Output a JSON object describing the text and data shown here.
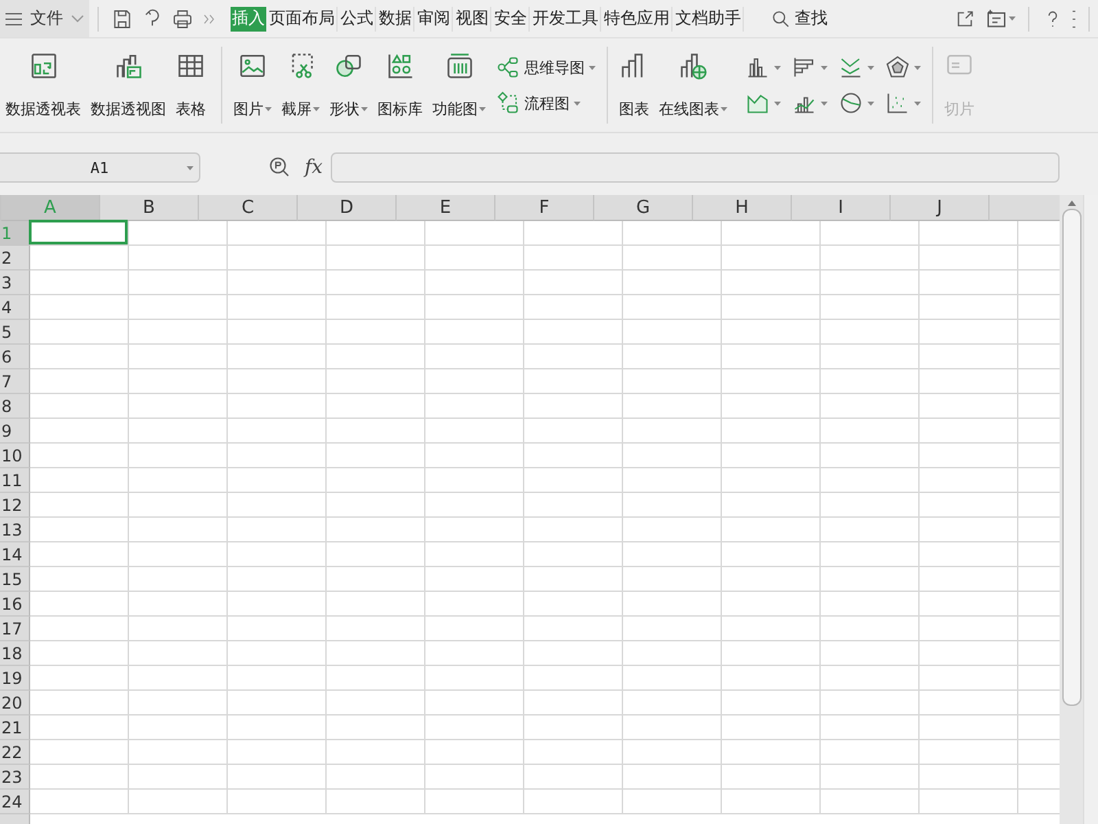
{
  "menu": {
    "label": "文件"
  },
  "tabs": [
    {
      "label": "插入",
      "selected": true
    },
    {
      "label": "页面布局",
      "selected": false
    },
    {
      "label": "公式",
      "selected": false
    },
    {
      "label": "数据",
      "selected": false
    },
    {
      "label": "审阅",
      "selected": false
    },
    {
      "label": "视图",
      "selected": false
    },
    {
      "label": "安全",
      "selected": false
    },
    {
      "label": "开发工具",
      "selected": false
    },
    {
      "label": "特色应用",
      "selected": false
    },
    {
      "label": "文档助手",
      "selected": false
    }
  ],
  "search": {
    "label": "查找"
  },
  "ribbon": [
    {
      "kind": "large",
      "label": "数据透视表",
      "dropdown": false,
      "disabled": false
    },
    {
      "kind": "large",
      "label": "数据透视图",
      "dropdown": false,
      "disabled": false
    },
    {
      "kind": "large",
      "label": "表格",
      "dropdown": false,
      "disabled": false
    },
    {
      "kind": "separator"
    },
    {
      "kind": "large",
      "label": "图片",
      "dropdown": true,
      "disabled": false
    },
    {
      "kind": "large",
      "label": "截屏",
      "dropdown": true,
      "disabled": false
    },
    {
      "kind": "large",
      "label": "形状",
      "dropdown": true,
      "disabled": false
    },
    {
      "kind": "large",
      "label": "图标库",
      "dropdown": false,
      "disabled": false
    },
    {
      "kind": "large",
      "label": "功能图",
      "dropdown": true,
      "disabled": false
    },
    {
      "kind": "stack",
      "items": [
        {
          "label": "思维导图",
          "dropdown": true
        },
        {
          "label": "流程图",
          "dropdown": true
        }
      ]
    },
    {
      "kind": "separator"
    },
    {
      "kind": "large",
      "label": "图表",
      "dropdown": false,
      "disabled": false
    },
    {
      "kind": "large",
      "label": "在线图表",
      "dropdown": true,
      "disabled": false
    },
    {
      "kind": "charts",
      "items": [
        {
          "kind": "column"
        },
        {
          "kind": "bar"
        },
        {
          "kind": "line"
        },
        {
          "kind": "radar"
        },
        {
          "kind": "area"
        },
        {
          "kind": "combo"
        },
        {
          "kind": "pie"
        },
        {
          "kind": "scatter"
        }
      ]
    },
    {
      "kind": "separator"
    },
    {
      "kind": "large",
      "label": "切片",
      "dropdown": false,
      "disabled": true
    }
  ],
  "name_box": {
    "value": "A1"
  },
  "formula_label": "fx",
  "columns": [
    {
      "label": "A",
      "selected": true
    },
    {
      "label": "B",
      "selected": false
    },
    {
      "label": "C",
      "selected": false
    },
    {
      "label": "D",
      "selected": false
    },
    {
      "label": "E",
      "selected": false
    },
    {
      "label": "F",
      "selected": false
    },
    {
      "label": "G",
      "selected": false
    },
    {
      "label": "H",
      "selected": false
    },
    {
      "label": "I",
      "selected": false
    },
    {
      "label": "J",
      "selected": false
    }
  ],
  "rows": [
    {
      "label": "1",
      "selected": true
    },
    {
      "label": "2",
      "selected": false
    },
    {
      "label": "3",
      "selected": false
    },
    {
      "label": "4",
      "selected": false
    },
    {
      "label": "5",
      "selected": false
    },
    {
      "label": "6",
      "selected": false
    },
    {
      "label": "7",
      "selected": false
    },
    {
      "label": "8",
      "selected": false
    },
    {
      "label": "9",
      "selected": false
    },
    {
      "label": "10",
      "selected": false
    },
    {
      "label": "11",
      "selected": false
    },
    {
      "label": "12",
      "selected": false
    },
    {
      "label": "13",
      "selected": false
    },
    {
      "label": "14",
      "selected": false
    },
    {
      "label": "15",
      "selected": false
    },
    {
      "label": "16",
      "selected": false
    },
    {
      "label": "17",
      "selected": false
    },
    {
      "label": "18",
      "selected": false
    },
    {
      "label": "19",
      "selected": false
    },
    {
      "label": "20",
      "selected": false
    },
    {
      "label": "21",
      "selected": false
    },
    {
      "label": "22",
      "selected": false
    },
    {
      "label": "23",
      "selected": false
    },
    {
      "label": "24",
      "selected": false
    }
  ]
}
